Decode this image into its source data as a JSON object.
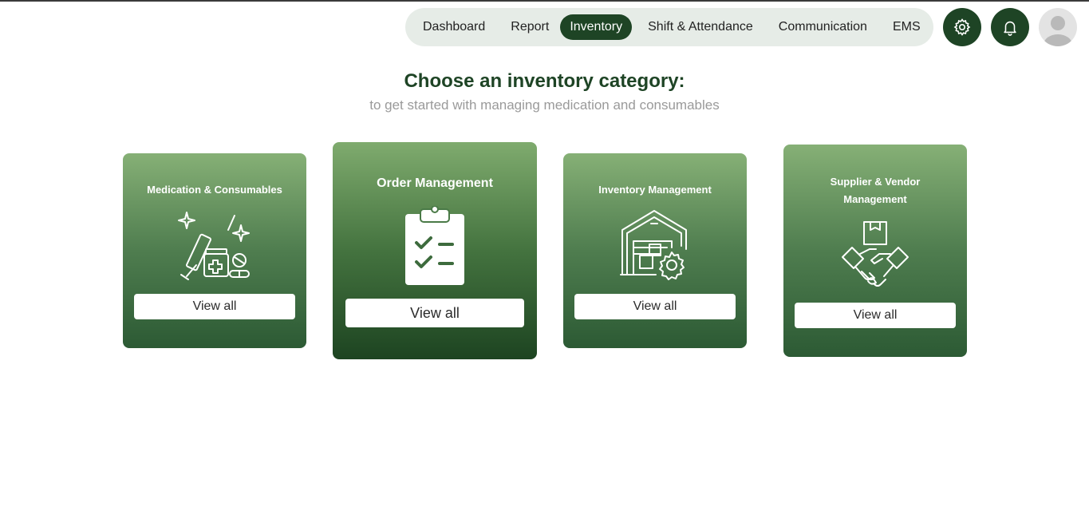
{
  "nav": {
    "items": [
      {
        "label": "Dashboard",
        "active": false
      },
      {
        "label": "Report",
        "active": false
      },
      {
        "label": "Inventory",
        "active": true
      },
      {
        "label": "Shift & Attendance",
        "active": false
      },
      {
        "label": "Communication",
        "active": false
      },
      {
        "label": "EMS",
        "active": false
      }
    ]
  },
  "header_icons": {
    "settings": "gear-icon",
    "notifications": "bell-icon",
    "profile": "avatar"
  },
  "page": {
    "title": "Choose an inventory category:",
    "subtitle": "to get started with managing medication and consumables"
  },
  "cards": [
    {
      "title": "Medication & Consumables",
      "button": "View all",
      "icon": "medication-icon"
    },
    {
      "title": "Order Management",
      "button": "View all",
      "icon": "clipboard-checklist-icon"
    },
    {
      "title": "Inventory Management",
      "button": "View all",
      "icon": "warehouse-icon"
    },
    {
      "title": "Supplier & Vendor Management",
      "button": "View all",
      "icon": "handshake-icon"
    }
  ],
  "colors": {
    "primary": "#1e4425",
    "nav_bg": "#e6ece7",
    "card_top": "#86b076",
    "card_bottom": "#2c5a34",
    "subtitle": "#9a9a9a"
  }
}
